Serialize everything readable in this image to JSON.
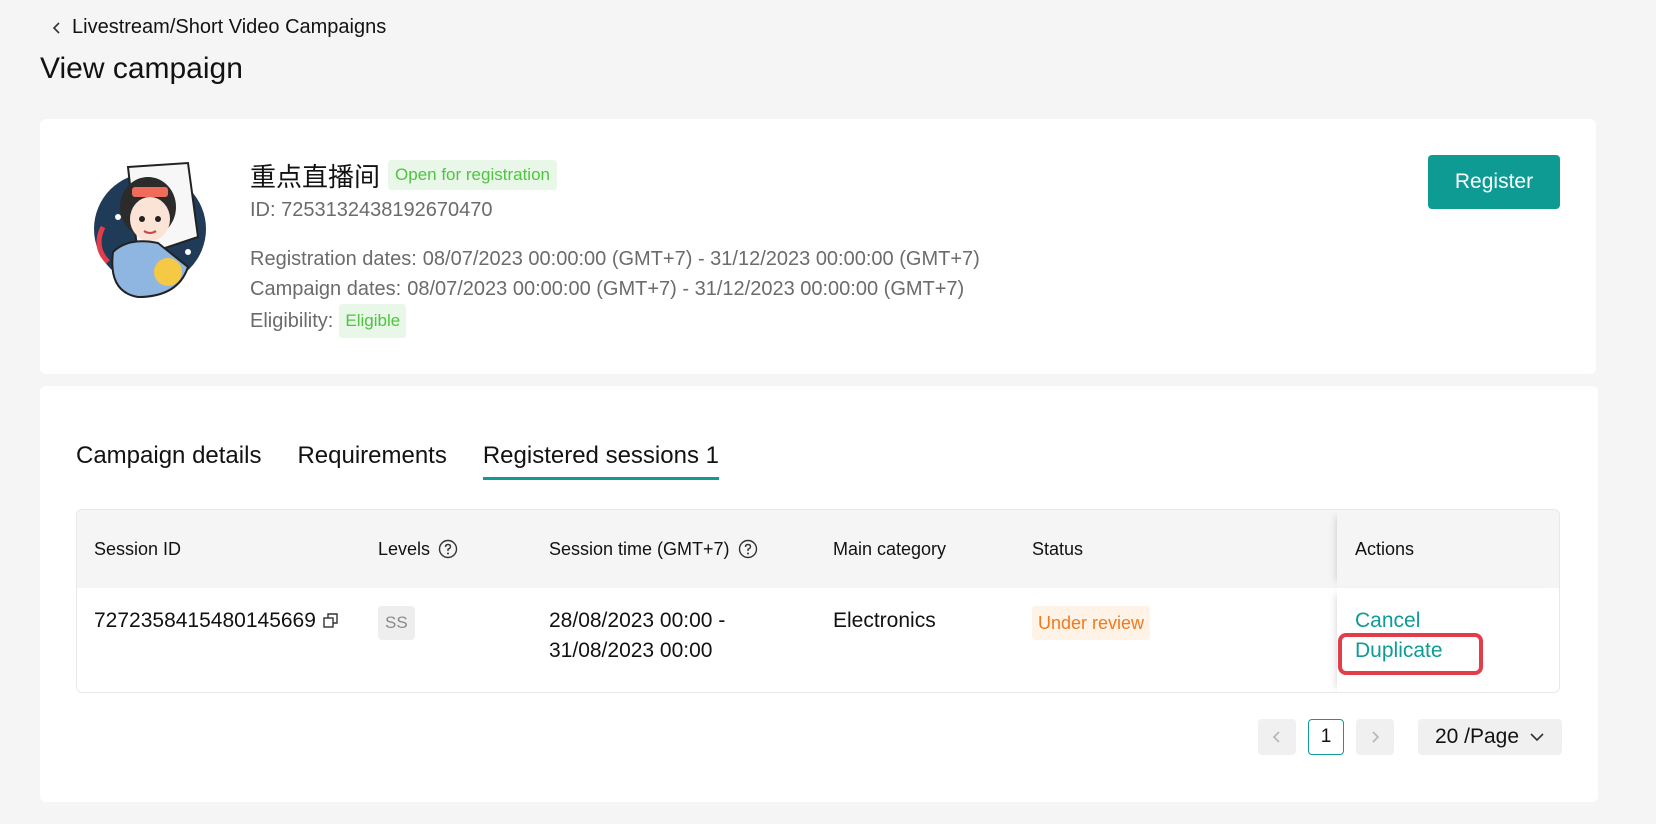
{
  "breadcrumb": {
    "label": "Livestream/Short Video Campaigns"
  },
  "page_title": "View campaign",
  "campaign": {
    "name": "重点直播间",
    "status": "Open for registration",
    "id": "ID: 7253132438192670470",
    "registration_label": "Registration dates:",
    "registration_dates": "08/07/2023 00:00:00 (GMT+7) - 31/12/2023 00:00:00 (GMT+7)",
    "campaign_label": "Campaign dates:",
    "campaign_dates": "08/07/2023 00:00:00 (GMT+7) - 31/12/2023 00:00:00 (GMT+7)",
    "eligibility_label": "Eligibility:",
    "eligibility": "Eligible",
    "register_label": "Register"
  },
  "tabs": [
    {
      "label": "Campaign details",
      "active": false
    },
    {
      "label": "Requirements",
      "active": false
    },
    {
      "label": "Registered sessions 1",
      "active": true
    }
  ],
  "table": {
    "headers": {
      "session_id": "Session ID",
      "levels": "Levels",
      "session_time": "Session time (GMT+7)",
      "main_category": "Main category",
      "status": "Status",
      "actions": "Actions"
    },
    "rows": [
      {
        "session_id": "7272358415480145669",
        "level": "SS",
        "time_start": "28/08/2023 00:00 -",
        "time_end": "31/08/2023 00:00",
        "main_category": "Electronics",
        "status": "Under review",
        "actions": {
          "cancel": "Cancel",
          "duplicate": "Duplicate"
        }
      }
    ]
  },
  "pagination": {
    "current_page": "1",
    "page_size": "20 /Page"
  },
  "colors": {
    "accent": "#0e9b94",
    "green_tag": "#4ec43f",
    "orange_tag": "#f07a1c",
    "highlight": "#e23d4b"
  }
}
